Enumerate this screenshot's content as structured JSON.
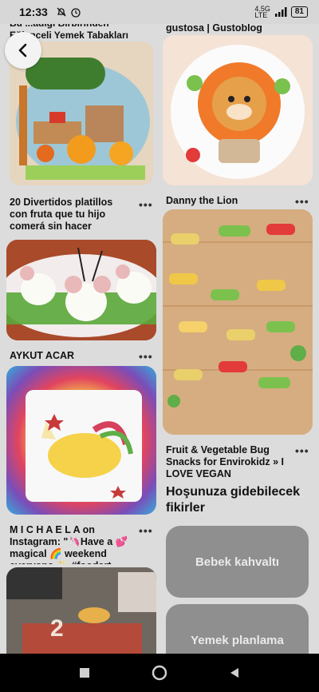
{
  "status_bar": {
    "time": "12:33",
    "network": "4.5G",
    "network_sub": "LTE",
    "battery": "81"
  },
  "pins": {
    "p1_caption": "Bu ...adigi Birbirinden\nEğlenceli Yemek Tabakları",
    "p2_caption": "gustosa | Gustoblog",
    "p3_caption": "20 Divertidos platillos\ncon fruta que tu hijo\ncomerá sin hacer\nberrinche",
    "p4_caption": "Danny the Lion",
    "p5_caption": "AYKUT ACAR",
    "p6_caption": "Fruit & Vegetable Bug\nSnacks for Envirokidz » I\nLOVE VEGAN",
    "p7_caption": "M I C H A E L A on\nInstagram: \"🦄Have a 💕\nmagical 🌈 weekend\neveryone ✨ #foodart"
  },
  "ideas": {
    "title": "Hoşunuza gidebilecek fikirler",
    "buttons": [
      "Bebek kahvaltı",
      "Yemek planlama"
    ]
  },
  "more_label": "•••",
  "colors": {
    "background": "#dcdcdc",
    "idea_button": "#8f8f8f",
    "navbar": "#000000"
  },
  "icons": [
    "back-arrow-icon",
    "mute-icon",
    "alarm-icon",
    "signal-icon",
    "battery-icon",
    "nav-back-icon",
    "nav-home-icon",
    "nav-recents-icon"
  ]
}
